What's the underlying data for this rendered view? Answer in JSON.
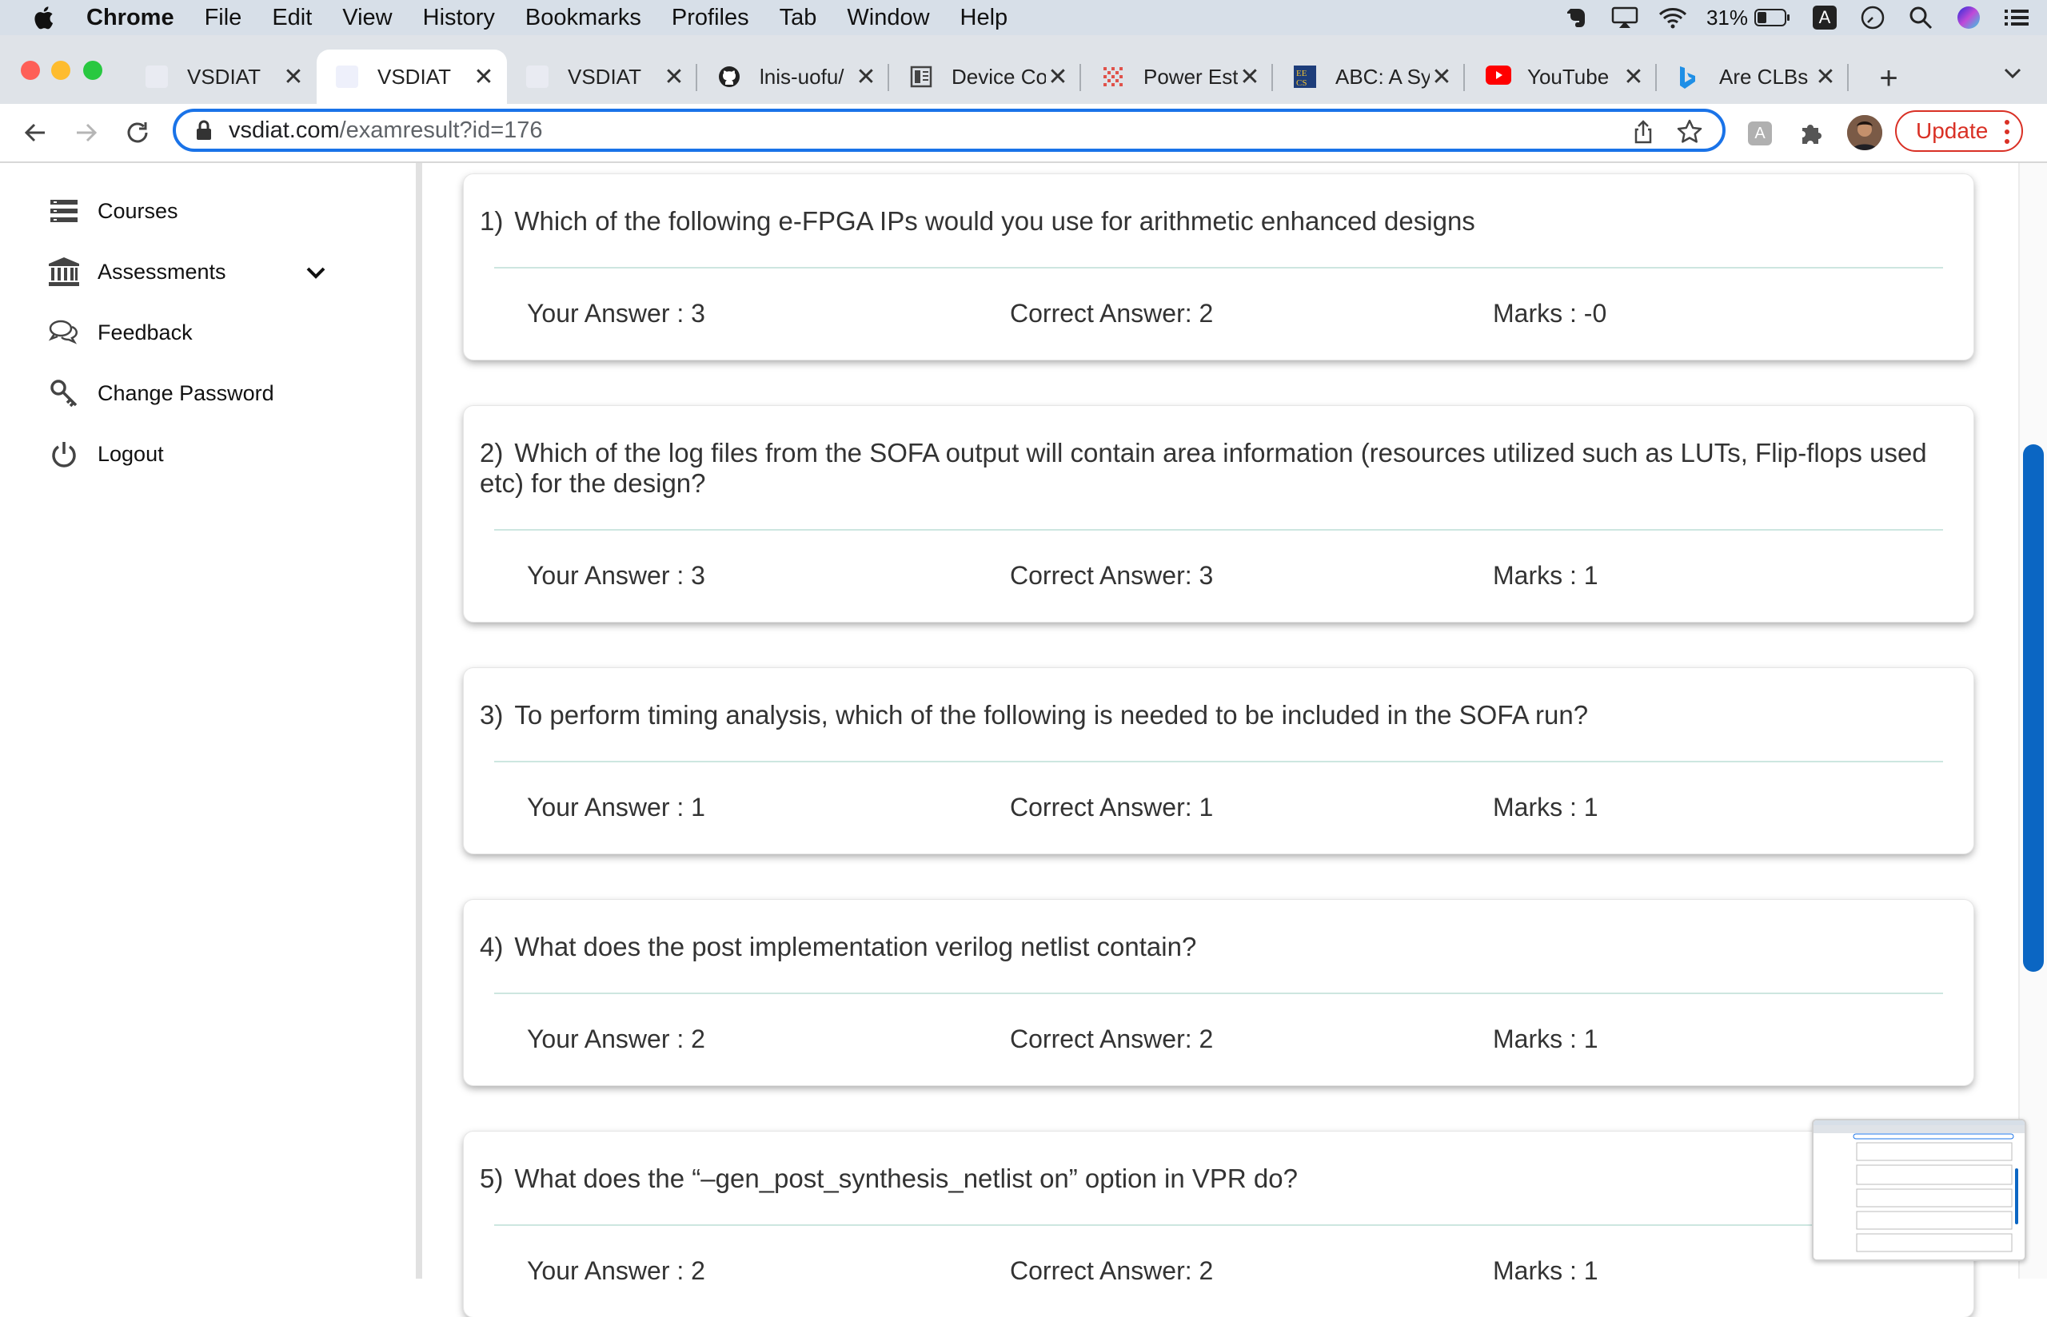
{
  "menubar": {
    "app_name": "Chrome",
    "items": [
      "File",
      "Edit",
      "View",
      "History",
      "Bookmarks",
      "Profiles",
      "Tab",
      "Window",
      "Help"
    ],
    "battery": "31%",
    "status_icons": [
      "evernote-icon",
      "airplay-icon",
      "wifi-icon",
      "battery-icon",
      "input-source-icon",
      "clock-icon",
      "spotlight-icon",
      "siri-icon",
      "control-center-icon"
    ],
    "input_source_letter": "A"
  },
  "tabs": [
    {
      "title": "VSDIAT",
      "icon": "vsdiat-favicon",
      "active": false
    },
    {
      "title": "VSDIAT",
      "icon": "vsdiat-favicon",
      "active": true
    },
    {
      "title": "VSDIAT",
      "icon": "vsdiat-favicon",
      "active": false
    },
    {
      "title": "lnis-uofu/",
      "icon": "github-icon",
      "active": false
    },
    {
      "title": "Device Co",
      "icon": "document-icon",
      "active": false
    },
    {
      "title": "Power Est",
      "icon": "grid-favicon",
      "active": false
    },
    {
      "title": "ABC: A Sy",
      "icon": "eecs-favicon",
      "active": false
    },
    {
      "title": "YouTube",
      "icon": "youtube-icon",
      "active": false
    },
    {
      "title": "Are CLBs",
      "icon": "bing-icon",
      "active": false
    }
  ],
  "omnibox": {
    "url_host": "vsdiat.com",
    "url_path": "/examresult?id=176"
  },
  "toolbar": {
    "update_label": "Update",
    "extension_letter": "A"
  },
  "sidebar": {
    "items": [
      {
        "label": "Courses",
        "icon": "courses-icon"
      },
      {
        "label": "Assessments",
        "icon": "bank-icon",
        "expandable": true
      },
      {
        "label": "Feedback",
        "icon": "chat-icon"
      },
      {
        "label": "Change Password",
        "icon": "key-icon"
      },
      {
        "label": "Logout",
        "icon": "power-icon"
      }
    ]
  },
  "results": [
    {
      "number": "1)",
      "question": "Which of the following e-FPGA IPs would you use for arithmetic enhanced designs",
      "your_answer": "Your Answer : 3",
      "correct_answer": "Correct Answer: 2",
      "marks": "Marks : -0"
    },
    {
      "number": "2)",
      "question": "Which of the log files from the SOFA output will contain area information (resources utilized such as LUTs, Flip-flops used etc) for the design?",
      "your_answer": "Your Answer : 3",
      "correct_answer": "Correct Answer: 3",
      "marks": "Marks : 1"
    },
    {
      "number": "3)",
      "question": "To perform timing analysis, which of the following is needed to be included in the SOFA run?",
      "your_answer": "Your Answer : 1",
      "correct_answer": "Correct Answer: 1",
      "marks": "Marks : 1"
    },
    {
      "number": "4)",
      "question": "What does the post implementation verilog netlist contain?",
      "your_answer": "Your Answer : 2",
      "correct_answer": "Correct Answer: 2",
      "marks": "Marks : 1"
    },
    {
      "number": "5)",
      "question": "What does the “–gen_post_synthesis_netlist on” option in VPR do?",
      "your_answer": "Your Answer : 2",
      "correct_answer": "Correct Answer: 2",
      "marks": "Marks : 1"
    }
  ],
  "colors": {
    "accent": "#1a73e8",
    "update": "#d93025",
    "scroll_thumb": "#0b66c3",
    "rule": "#cde6e0"
  }
}
